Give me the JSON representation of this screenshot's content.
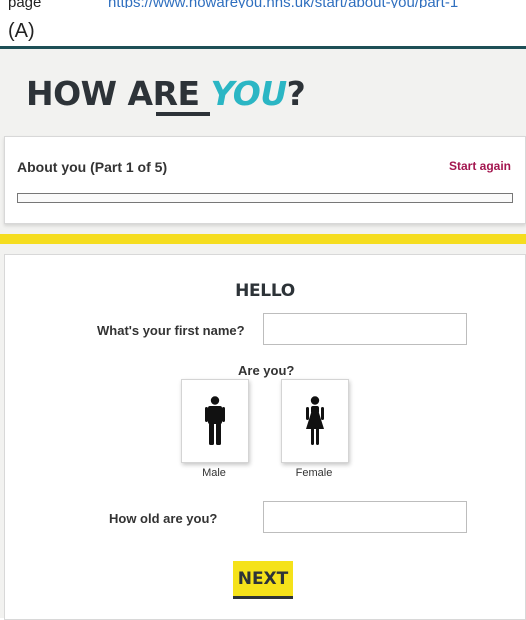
{
  "caption": {
    "page_prefix": "page",
    "link_text": "https://www.howareyou.nhs.uk/start/about-you/part-1",
    "label": "(A)"
  },
  "logo": {
    "text_before": "HOW ARE ",
    "text_highlight": "YOU",
    "text_after": "?"
  },
  "progress": {
    "title": "About you (Part 1 of 5)",
    "start_again": "Start again",
    "fraction": 0
  },
  "form": {
    "heading": "HELLO",
    "first_name_label": "What's your first name?",
    "first_name_value": "",
    "gender_question": "Are you?",
    "gender_options": [
      {
        "label": "Male",
        "icon": "male-figure-icon"
      },
      {
        "label": "Female",
        "icon": "female-figure-icon"
      }
    ],
    "age_label": "How old are you?",
    "age_value": "",
    "next_label": "NEXT"
  },
  "colors": {
    "accent_teal": "#2bb6c4",
    "dark": "#2d3338",
    "yellow": "#f5dd1f",
    "link_magenta": "#a3164f",
    "rule_teal": "#1d4f56"
  }
}
